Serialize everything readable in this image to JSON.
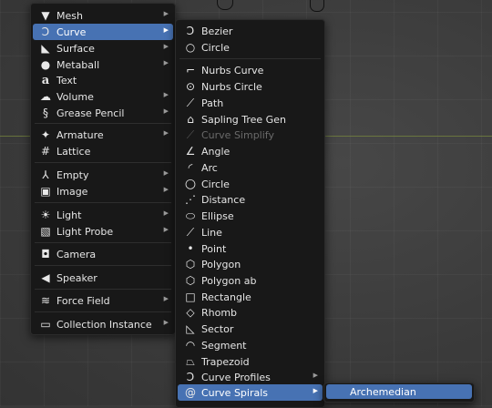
{
  "add_menu": {
    "items": [
      {
        "label": "Mesh",
        "icon": "mesh-icon",
        "submenu": true
      },
      {
        "label": "Curve",
        "icon": "curve-icon",
        "submenu": true,
        "active": true
      },
      {
        "label": "Surface",
        "icon": "surface-icon",
        "submenu": true
      },
      {
        "label": "Metaball",
        "icon": "metaball-icon",
        "submenu": true
      },
      {
        "label": "Text",
        "icon": "text-icon",
        "submenu": false
      },
      {
        "label": "Volume",
        "icon": "volume-icon",
        "submenu": true
      },
      {
        "label": "Grease Pencil",
        "icon": "grease-pencil-icon",
        "submenu": true
      },
      {
        "label": "Armature",
        "icon": "armature-icon",
        "submenu": true
      },
      {
        "label": "Lattice",
        "icon": "lattice-icon",
        "submenu": false
      },
      {
        "label": "Empty",
        "icon": "empty-icon",
        "submenu": true
      },
      {
        "label": "Image",
        "icon": "image-icon",
        "submenu": true
      },
      {
        "label": "Light",
        "icon": "light-icon",
        "submenu": true
      },
      {
        "label": "Light Probe",
        "icon": "light-probe-icon",
        "submenu": true
      },
      {
        "label": "Camera",
        "icon": "camera-icon",
        "submenu": false
      },
      {
        "label": "Speaker",
        "icon": "speaker-icon",
        "submenu": false
      },
      {
        "label": "Force Field",
        "icon": "force-field-icon",
        "submenu": true
      },
      {
        "label": "Collection Instance",
        "icon": "collection-instance-icon",
        "submenu": true
      }
    ]
  },
  "curve_menu": {
    "items": [
      {
        "label": "Bezier",
        "icon": "bezier-curve-icon"
      },
      {
        "label": "Circle",
        "icon": "bezier-circle-icon"
      },
      {
        "label": "Nurbs Curve",
        "icon": "nurbs-curve-icon"
      },
      {
        "label": "Nurbs Circle",
        "icon": "nurbs-circle-icon"
      },
      {
        "label": "Path",
        "icon": "path-icon"
      },
      {
        "label": "Sapling Tree Gen",
        "icon": "tree-icon"
      },
      {
        "label": "Curve Simplify",
        "icon": "curve-simplify-icon",
        "disabled": true
      },
      {
        "label": "Angle",
        "icon": "angle-icon"
      },
      {
        "label": "Arc",
        "icon": "arc-icon"
      },
      {
        "label": "Circle",
        "icon": "circle-icon"
      },
      {
        "label": "Distance",
        "icon": "distance-icon"
      },
      {
        "label": "Ellipse",
        "icon": "ellipse-icon"
      },
      {
        "label": "Line",
        "icon": "line-icon"
      },
      {
        "label": "Point",
        "icon": "point-icon"
      },
      {
        "label": "Polygon",
        "icon": "polygon-icon"
      },
      {
        "label": "Polygon ab",
        "icon": "polygon-ab-icon"
      },
      {
        "label": "Rectangle",
        "icon": "rectangle-icon"
      },
      {
        "label": "Rhomb",
        "icon": "rhomb-icon"
      },
      {
        "label": "Sector",
        "icon": "sector-icon"
      },
      {
        "label": "Segment",
        "icon": "segment-icon"
      },
      {
        "label": "Trapezoid",
        "icon": "trapezoid-icon"
      },
      {
        "label": "Curve Profiles",
        "icon": "curve-profiles-icon",
        "submenu": true
      },
      {
        "label": "Curve Spirals",
        "icon": "curve-spirals-icon",
        "submenu": true,
        "active": true
      }
    ]
  },
  "spiral_menu": {
    "items": [
      {
        "label": "Archemedian",
        "active": true
      }
    ]
  }
}
